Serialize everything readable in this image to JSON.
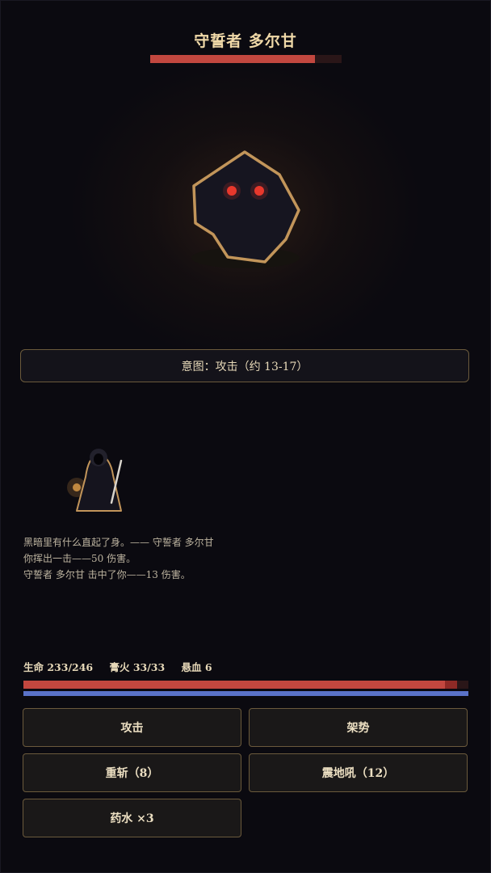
{
  "boss": {
    "name": "守誓者 多尔甘",
    "hp_fraction": 0.86
  },
  "intent": {
    "text": "意图：攻击（约 13-17）"
  },
  "log": [
    "黑暗里有什么直起了身。—— 守誓者 多尔甘",
    "你挥出一击——50 伤害。",
    "守誓者 多尔甘 击中了你——13 伤害。"
  ],
  "player": {
    "hp_text": "生命 233/246",
    "fire_text": "膏火 33/33",
    "bleed_text": "悬血 6",
    "hp_fraction": 0.9472,
    "recent_damage_fraction": 0.0271,
    "fire_fraction": 1.0
  },
  "actions": {
    "attack": "攻击",
    "stance": "架势",
    "heavy_slash": "重斩（8）",
    "quake_roar": "震地吼（12）",
    "potion": "药水 ×3"
  },
  "colors": {
    "background": "#0b0a10",
    "accent_gold": "#c89a5c",
    "hp_red": "#c2473f",
    "fire_blue": "#5a72c8",
    "boss_eyes": "#e8382c"
  },
  "icons": {
    "boss": "stone-golem-sprite",
    "player": "hooded-warrior-sprite"
  }
}
